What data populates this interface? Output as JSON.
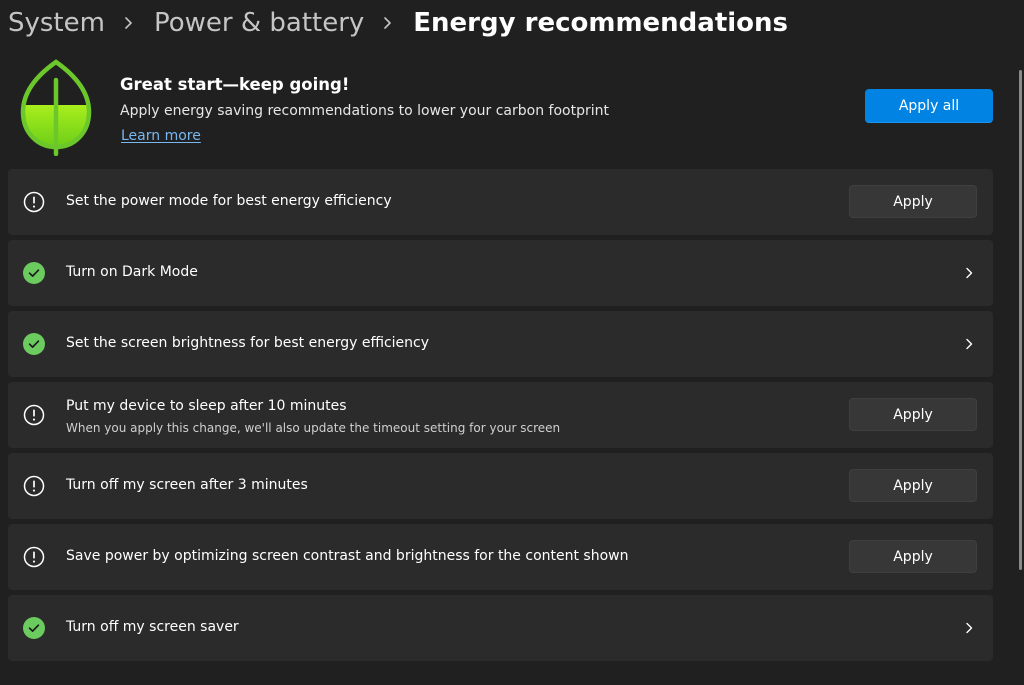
{
  "breadcrumb": {
    "items": [
      "System",
      "Power & battery",
      "Energy recommendations"
    ]
  },
  "hero": {
    "icon": "leaf-icon",
    "title": "Great start—keep going!",
    "subtitle": "Apply energy saving recommendations to lower your carbon footprint",
    "link": "Learn more",
    "apply_all": "Apply all",
    "accent": "#0083e2",
    "leaf_color": "#7fd41a"
  },
  "recommendations": [
    {
      "status": "pending",
      "icon": "warning-circle-icon",
      "label": "Set the power mode for best energy efficiency",
      "button": "Apply"
    },
    {
      "status": "done",
      "icon": "check-circle-icon",
      "label": "Turn on Dark Mode"
    },
    {
      "status": "done",
      "icon": "check-circle-icon",
      "label": "Set the screen brightness for best energy efficiency"
    },
    {
      "status": "pending",
      "icon": "warning-circle-icon",
      "label": "Put my device to sleep after 10 minutes",
      "description": "When you apply this change, we'll also update the timeout setting for your screen",
      "button": "Apply"
    },
    {
      "status": "pending",
      "icon": "warning-circle-icon",
      "label": "Turn off my screen after 3 minutes",
      "button": "Apply"
    },
    {
      "status": "pending",
      "icon": "warning-circle-icon",
      "label": "Save power by optimizing screen contrast and brightness for the content shown",
      "button": "Apply"
    },
    {
      "status": "done",
      "icon": "check-circle-icon",
      "label": "Turn off my screen saver"
    }
  ],
  "colors": {
    "background": "#202020",
    "card": "#2b2b2b",
    "success": "#6ccb5f",
    "link": "#79b7ef"
  }
}
